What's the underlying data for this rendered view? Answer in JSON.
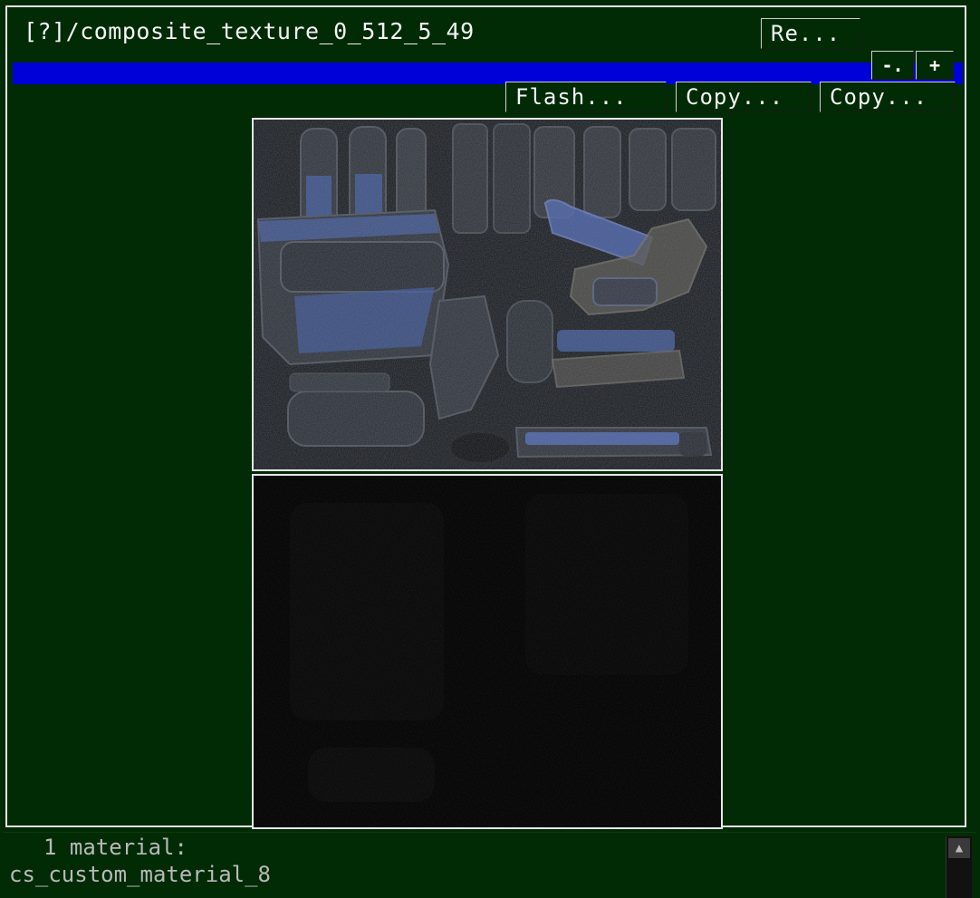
{
  "panel": {
    "title": "[?]/composite_texture_0_512_5_49",
    "refresh_label": "Re...",
    "zoom_out_label": "-.",
    "zoom_in_label": "+",
    "flash_label": "Flash...",
    "copy1_label": "Copy...",
    "copy2_label": "Copy..."
  },
  "status": {
    "count_line": "1 material:",
    "material_name": "cs_custom_material_8"
  },
  "colors": {
    "panel_bg": "#002b05",
    "highlight_bar": "#0000d8",
    "border": "#e8e8e8"
  }
}
